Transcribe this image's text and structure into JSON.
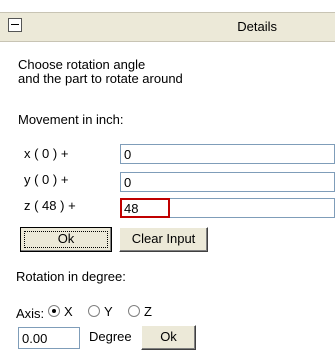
{
  "header": {
    "title": "Details"
  },
  "intro": {
    "line1": "Choose rotation angle",
    "line2": "and the part to rotate around"
  },
  "movement": {
    "heading": "Movement in inch:",
    "rows": [
      {
        "label": "x ( 0 ) +",
        "value": "0"
      },
      {
        "label": "y ( 0 ) +",
        "value": "0"
      },
      {
        "label": "z ( 48 ) +",
        "value": "48"
      }
    ],
    "ok_label": "Ok",
    "clear_label": "Clear Input"
  },
  "rotation": {
    "heading": "Rotation in degree:",
    "axis_label": "Axis:",
    "axes": [
      {
        "label": "X",
        "checked": true
      },
      {
        "label": "Y",
        "checked": false
      },
      {
        "label": "Z",
        "checked": false
      }
    ],
    "degree_value": "0.00",
    "degree_label": "Degree",
    "ok_label": "Ok"
  }
}
